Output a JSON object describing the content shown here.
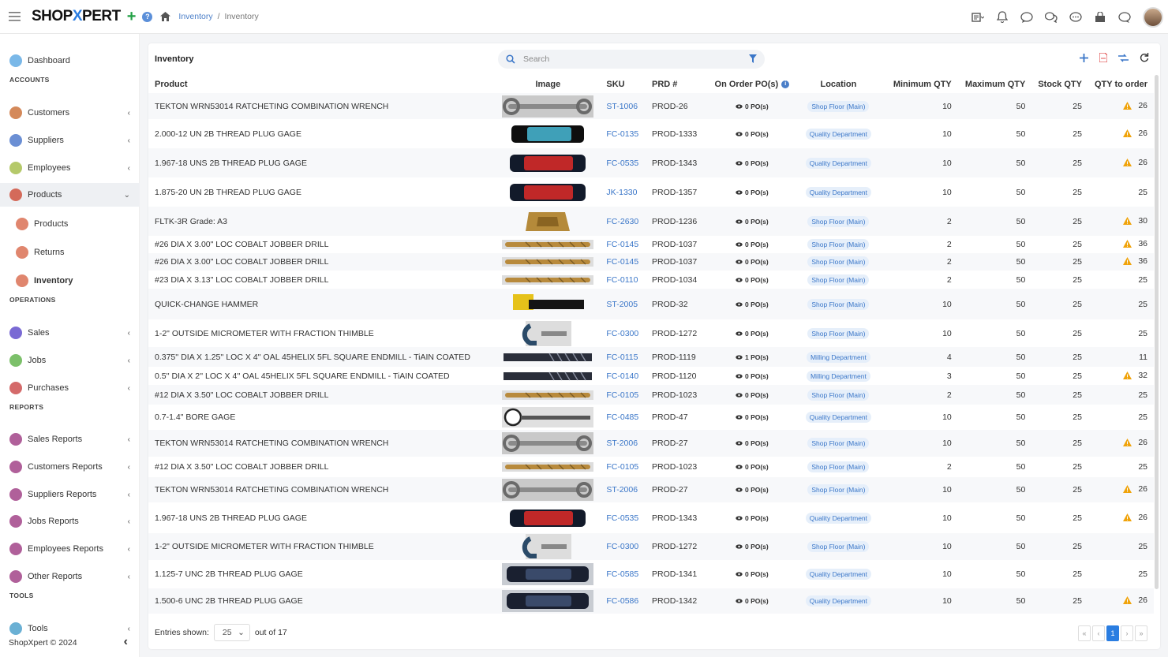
{
  "app": {
    "brand_left": "SHOP",
    "brand_x": "X",
    "brand_right": "PERT",
    "breadcrumb": [
      "Inventory",
      "Inventory"
    ],
    "footer": "ShopXpert © 2024"
  },
  "sidebar": {
    "items": [
      {
        "label": "Dashboard",
        "color": "#7ab8e8"
      },
      {
        "section": "ACCOUNTS"
      },
      {
        "label": "Customers",
        "color": "#d4895a",
        "chevron": true
      },
      {
        "label": "Suppliers",
        "color": "#6b8fd4",
        "chevron": true
      },
      {
        "label": "Employees",
        "color": "#b5c96a",
        "chevron": true
      },
      {
        "label": "Products",
        "color": "#d46a5a",
        "chevron": true,
        "open": true
      },
      {
        "label": "Products",
        "color": "#e0866e",
        "sub": true
      },
      {
        "label": "Returns",
        "color": "#e0866e",
        "sub": true
      },
      {
        "label": "Inventory",
        "color": "#e0866e",
        "sub": true,
        "active": true
      },
      {
        "section": "OPERATIONS"
      },
      {
        "label": "Sales",
        "color": "#7a6ad4",
        "chevron": true
      },
      {
        "label": "Jobs",
        "color": "#7cc06a",
        "chevron": true
      },
      {
        "label": "Purchases",
        "color": "#d46a6a",
        "chevron": true
      },
      {
        "section": "REPORTS"
      },
      {
        "label": "Sales Reports",
        "color": "#b0609a",
        "chevron": true
      },
      {
        "label": "Customers Reports",
        "color": "#b0609a",
        "chevron": true
      },
      {
        "label": "Suppliers Reports",
        "color": "#b0609a",
        "chevron": true
      },
      {
        "label": "Jobs Reports",
        "color": "#b0609a",
        "chevron": true
      },
      {
        "label": "Employees Reports",
        "color": "#b0609a",
        "chevron": true
      },
      {
        "label": "Other Reports",
        "color": "#b0609a",
        "chevron": true
      },
      {
        "section": "TOOLS"
      },
      {
        "label": "Tools",
        "color": "#6ab0d4",
        "chevron": true
      }
    ]
  },
  "card": {
    "title": "Inventory",
    "search_placeholder": "Search"
  },
  "table": {
    "headers": [
      "Product",
      "Image",
      "SKU",
      "PRD #",
      "On Order PO(s)",
      "Location",
      "Minimum QTY",
      "Maximum QTY",
      "Stock QTY",
      "QTY to order"
    ],
    "rows": [
      {
        "product": "TEKTON WRN53014 RATCHETING COMBINATION WRENCH",
        "img": "wrench",
        "sku": "ST-1006",
        "prd": "PROD-26",
        "po": "0 PO(s)",
        "loc": "Shop Floor (Main)",
        "min": "10",
        "max": "50",
        "stock": "25",
        "qto": "26",
        "warn": true
      },
      {
        "product": "2.000-12 UN 2B THREAD PLUG GAGE",
        "img": "gage-blue",
        "sku": "FC-0135",
        "prd": "PROD-1333",
        "po": "0 PO(s)",
        "loc": "Quality Department",
        "min": "10",
        "max": "50",
        "stock": "25",
        "qto": "26",
        "warn": true
      },
      {
        "product": "1.967-18 UNS 2B THREAD PLUG GAGE",
        "img": "gage-red",
        "sku": "FC-0535",
        "prd": "PROD-1343",
        "po": "0 PO(s)",
        "loc": "Quality Department",
        "min": "10",
        "max": "50",
        "stock": "25",
        "qto": "26",
        "warn": true
      },
      {
        "product": "1.875-20 UN 2B THREAD PLUG GAGE",
        "img": "gage-red",
        "sku": "JK-1330",
        "prd": "PROD-1357",
        "po": "0 PO(s)",
        "loc": "Quality Department",
        "min": "10",
        "max": "50",
        "stock": "25",
        "qto": "25",
        "warn": false
      },
      {
        "product": "FLTK-3R Grade: A3",
        "img": "insert",
        "sku": "FC-2630",
        "prd": "PROD-1236",
        "po": "0 PO(s)",
        "loc": "Shop Floor (Main)",
        "min": "2",
        "max": "50",
        "stock": "25",
        "qto": "30",
        "warn": true
      },
      {
        "product": "#26 DIA X 3.00\" LOC COBALT JOBBER DRILL",
        "img": "drill",
        "sku": "FC-0145",
        "prd": "PROD-1037",
        "po": "0 PO(s)",
        "loc": "Shop Floor (Main)",
        "min": "2",
        "max": "50",
        "stock": "25",
        "qto": "36",
        "warn": true
      },
      {
        "product": "#26 DIA X 3.00\" LOC COBALT JOBBER DRILL",
        "img": "drill",
        "sku": "FC-0145",
        "prd": "PROD-1037",
        "po": "0 PO(s)",
        "loc": "Shop Floor (Main)",
        "min": "2",
        "max": "50",
        "stock": "25",
        "qto": "36",
        "warn": true
      },
      {
        "product": "#23 DIA X 3.13\" LOC COBALT JOBBER DRILL",
        "img": "drill",
        "sku": "FC-0110",
        "prd": "PROD-1034",
        "po": "0 PO(s)",
        "loc": "Shop Floor (Main)",
        "min": "2",
        "max": "50",
        "stock": "25",
        "qto": "25",
        "warn": false
      },
      {
        "product": "QUICK-CHANGE HAMMER",
        "img": "hammer",
        "sku": "ST-2005",
        "prd": "PROD-32",
        "po": "0 PO(s)",
        "loc": "Shop Floor (Main)",
        "min": "10",
        "max": "50",
        "stock": "25",
        "qto": "25",
        "warn": false
      },
      {
        "product": "1-2\" OUTSIDE MICROMETER WITH FRACTION THIMBLE",
        "img": "micrometer",
        "sku": "FC-0300",
        "prd": "PROD-1272",
        "po": "0 PO(s)",
        "loc": "Shop Floor (Main)",
        "min": "10",
        "max": "50",
        "stock": "25",
        "qto": "25",
        "warn": false
      },
      {
        "product": "0.375'' DIA X 1.25'' LOC X 4'' OAL 45HELIX 5FL SQUARE ENDMILL - TiAIN COATED",
        "img": "endmill",
        "sku": "FC-0115",
        "prd": "PROD-1119",
        "po": "1 PO(s)",
        "loc": "Milling Department",
        "min": "4",
        "max": "50",
        "stock": "25",
        "qto": "11",
        "warn": false
      },
      {
        "product": "0.5'' DIA X 2'' LOC X 4'' OAL 45HELIX 5FL SQUARE ENDMILL - TiAIN COATED",
        "img": "endmill",
        "sku": "FC-0140",
        "prd": "PROD-1120",
        "po": "0 PO(s)",
        "loc": "Milling Department",
        "min": "3",
        "max": "50",
        "stock": "25",
        "qto": "32",
        "warn": true
      },
      {
        "product": "#12 DIA X 3.50\" LOC COBALT JOBBER DRILL",
        "img": "drill",
        "sku": "FC-0105",
        "prd": "PROD-1023",
        "po": "0 PO(s)",
        "loc": "Shop Floor (Main)",
        "min": "2",
        "max": "50",
        "stock": "25",
        "qto": "25",
        "warn": false
      },
      {
        "product": "0.7-1.4\" BORE GAGE",
        "img": "boregage",
        "sku": "FC-0485",
        "prd": "PROD-47",
        "po": "0 PO(s)",
        "loc": "Quality Department",
        "min": "10",
        "max": "50",
        "stock": "25",
        "qto": "25",
        "warn": false
      },
      {
        "product": "TEKTON WRN53014 RATCHETING COMBINATION WRENCH",
        "img": "wrench",
        "sku": "ST-2006",
        "prd": "PROD-27",
        "po": "0 PO(s)",
        "loc": "Shop Floor (Main)",
        "min": "10",
        "max": "50",
        "stock": "25",
        "qto": "26",
        "warn": true
      },
      {
        "product": "#12 DIA X 3.50\" LOC COBALT JOBBER DRILL",
        "img": "drill",
        "sku": "FC-0105",
        "prd": "PROD-1023",
        "po": "0 PO(s)",
        "loc": "Shop Floor (Main)",
        "min": "2",
        "max": "50",
        "stock": "25",
        "qto": "25",
        "warn": false
      },
      {
        "product": "TEKTON WRN53014 RATCHETING COMBINATION WRENCH",
        "img": "wrench",
        "sku": "ST-2006",
        "prd": "PROD-27",
        "po": "0 PO(s)",
        "loc": "Shop Floor (Main)",
        "min": "10",
        "max": "50",
        "stock": "25",
        "qto": "26",
        "warn": true
      },
      {
        "product": "1.967-18 UNS 2B THREAD PLUG GAGE",
        "img": "gage-red",
        "sku": "FC-0535",
        "prd": "PROD-1343",
        "po": "0 PO(s)",
        "loc": "Quality Department",
        "min": "10",
        "max": "50",
        "stock": "25",
        "qto": "26",
        "warn": true
      },
      {
        "product": "1-2\" OUTSIDE MICROMETER WITH FRACTION THIMBLE",
        "img": "micrometer",
        "sku": "FC-0300",
        "prd": "PROD-1272",
        "po": "0 PO(s)",
        "loc": "Shop Floor (Main)",
        "min": "10",
        "max": "50",
        "stock": "25",
        "qto": "25",
        "warn": false
      },
      {
        "product": "1.125-7 UNC 2B THREAD PLUG GAGE",
        "img": "gage-dark",
        "sku": "FC-0585",
        "prd": "PROD-1341",
        "po": "0 PO(s)",
        "loc": "Quality Department",
        "min": "10",
        "max": "50",
        "stock": "25",
        "qto": "25",
        "warn": false
      },
      {
        "product": "1.500-6 UNC 2B THREAD PLUG GAGE",
        "img": "gage-dark",
        "sku": "FC-0586",
        "prd": "PROD-1342",
        "po": "0 PO(s)",
        "loc": "Quality Department",
        "min": "10",
        "max": "50",
        "stock": "25",
        "qto": "26",
        "warn": true
      }
    ]
  },
  "footer": {
    "entries_label": "Entries shown:",
    "entries_value": "25",
    "out_of": "out of 17",
    "current_page": "1"
  },
  "colors": {
    "accent": "#2a7de1",
    "warn": "#f0a30a",
    "sku_link": "#3a76c8"
  }
}
